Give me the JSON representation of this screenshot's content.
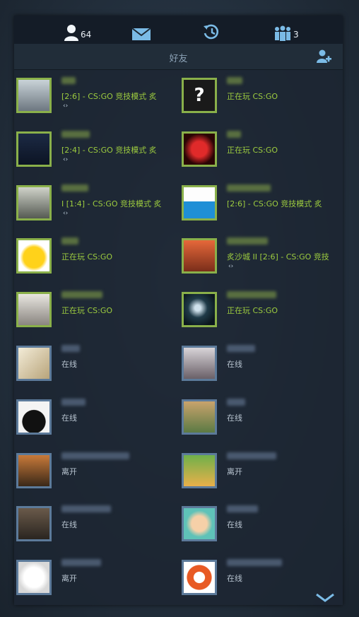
{
  "topbar": {
    "friends_count": "64",
    "groups_count": "3",
    "friends_icon": "person-icon",
    "mail_icon": "mail-icon",
    "history_icon": "history-icon",
    "groups_icon": "group-icon"
  },
  "panel_title": "好友",
  "colors": {
    "in_game": "#9dcc3f",
    "online": "#b8c4d0",
    "in_game_border": "#8ab04a",
    "online_border": "#5c7a9a"
  },
  "friends": [
    {
      "status": "[2:6] - CS:GO 竞技模式 炙",
      "state": "game",
      "extra": "‹›",
      "avatar": "raccoon-avatar"
    },
    {
      "status": "正在玩 CS:GO",
      "state": "game",
      "extra": "",
      "avatar": "question-mark-avatar"
    },
    {
      "status": "[2:4] - CS:GO 竞技模式 炙",
      "state": "game",
      "extra": "‹›",
      "avatar": "dark-emblem-avatar"
    },
    {
      "status": "正在玩 CS:GO",
      "state": "game",
      "extra": "",
      "avatar": "red-logo-avatar"
    },
    {
      "status": "I [1:4] - CS:GO 竞技模式 炙",
      "state": "game",
      "extra": "‹›",
      "avatar": "blond-character-avatar"
    },
    {
      "status": "[2:6] - CS:GO 竞技模式 炙",
      "state": "game",
      "extra": "",
      "avatar": "durex-avatar"
    },
    {
      "status": "正在玩 CS:GO",
      "state": "game",
      "extra": "",
      "avatar": "yellow-blob-avatar"
    },
    {
      "status": "炙沙城 II [2:6] - CS:GO 竞技",
      "state": "game",
      "extra": "‹›",
      "avatar": "anime-girl-avatar"
    },
    {
      "status": "正在玩 CS:GO",
      "state": "game",
      "extra": "",
      "avatar": "sketch-avatar"
    },
    {
      "status": "正在玩 CS:GO",
      "state": "game",
      "extra": "",
      "avatar": "night-moon-avatar"
    },
    {
      "status": "在线",
      "state": "online",
      "extra": "",
      "avatar": "pinwheel-avatar"
    },
    {
      "status": "在线",
      "state": "online",
      "extra": "",
      "avatar": "anime-pair-avatar"
    },
    {
      "status": "在线",
      "state": "online",
      "extra": "",
      "avatar": "black-cat-avatar"
    },
    {
      "status": "在线",
      "state": "online",
      "extra": "",
      "avatar": "dog-avatar"
    },
    {
      "status": "离开",
      "state": "online",
      "extra": "",
      "avatar": "sunglasses-man-avatar"
    },
    {
      "status": "离开",
      "state": "online",
      "extra": "",
      "avatar": "cartoon-fighter-avatar"
    },
    {
      "status": "在线",
      "state": "online",
      "extra": "",
      "avatar": "tattoo-avatar"
    },
    {
      "status": "在线",
      "state": "online",
      "extra": "",
      "avatar": "cartoon-frog-avatar"
    },
    {
      "status": "离开",
      "state": "online",
      "extra": "",
      "avatar": "dalmatian-avatar"
    },
    {
      "status": "在线",
      "state": "online",
      "extra": "",
      "avatar": "orange-logo-avatar"
    }
  ]
}
